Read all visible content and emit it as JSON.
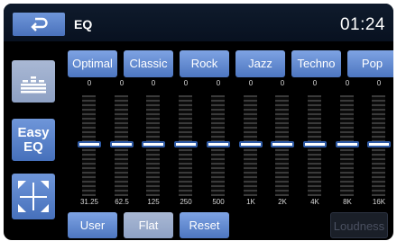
{
  "header": {
    "title": "EQ",
    "clock": "01:24"
  },
  "sidebar": {
    "easy_eq_line1": "Easy",
    "easy_eq_line2": "EQ"
  },
  "presets": [
    "Optimal",
    "Classic",
    "Rock",
    "Jazz",
    "Techno",
    "Pop"
  ],
  "bands": [
    {
      "freq": "31.25",
      "value": "0",
      "level": 0
    },
    {
      "freq": "62.5",
      "value": "0",
      "level": 0
    },
    {
      "freq": "125",
      "value": "0",
      "level": 0
    },
    {
      "freq": "250",
      "value": "0",
      "level": 0
    },
    {
      "freq": "500",
      "value": "0",
      "level": 0
    },
    {
      "freq": "1K",
      "value": "0",
      "level": 0
    },
    {
      "freq": "2K",
      "value": "0",
      "level": 0
    },
    {
      "freq": "4K",
      "value": "0",
      "level": 0
    },
    {
      "freq": "8K",
      "value": "0",
      "level": 0
    },
    {
      "freq": "16K",
      "value": "0",
      "level": 0
    }
  ],
  "bottom": {
    "user": "User",
    "flat": "Flat",
    "reset": "Reset",
    "loudness": "Loudness"
  },
  "colors": {
    "accent": "#5a83cc",
    "selected": "#9aaccb",
    "background": "#000000"
  }
}
